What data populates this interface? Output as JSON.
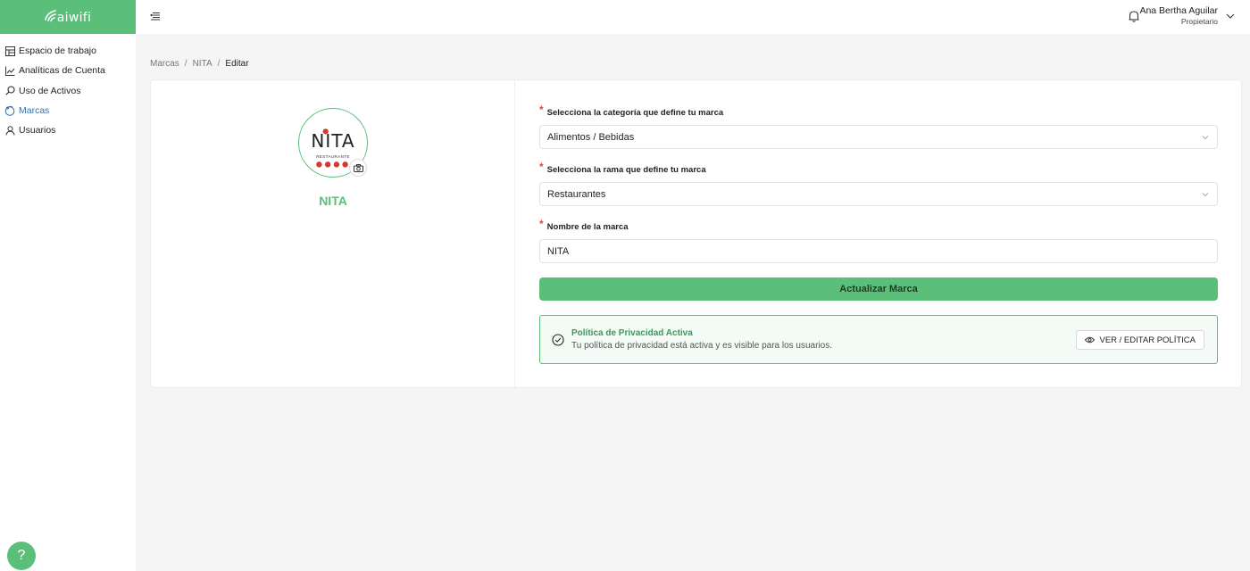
{
  "logo": {
    "text": "aiwifi"
  },
  "sidebar": {
    "items": [
      {
        "label": "Espacio de trabajo",
        "icon": "workspace-icon"
      },
      {
        "label": "Analíticas de Cuenta",
        "icon": "chart-icon"
      },
      {
        "label": "Uso de Activos",
        "icon": "search-icon"
      },
      {
        "label": "Marcas",
        "icon": "brand-icon",
        "active": true
      },
      {
        "label": "Usuarios",
        "icon": "user-icon"
      }
    ]
  },
  "help": {
    "label": "?"
  },
  "topbar": {
    "user_name": "Ana Bertha Aguilar",
    "user_role": "Propietario"
  },
  "breadcrumb": {
    "items": [
      "Marcas",
      "NITA",
      "Editar"
    ],
    "separator": "/"
  },
  "brand": {
    "name": "NITA",
    "logo_word": "NITA",
    "logo_sub": "RESTAURANTE"
  },
  "form": {
    "category_label": "Selecciona la categoría que define tu marca",
    "category_value": "Alimentos / Bebidas",
    "branch_label": "Selecciona la rama que define tu marca",
    "branch_value": "Restaurantes",
    "name_label": "Nombre de la marca",
    "name_value": "NITA",
    "required_mark": "*",
    "submit_label": "Actualizar Marca"
  },
  "policy": {
    "title": "Política de Privacidad Activa",
    "description": "Tu política de privacidad está activa y es visible para los usuarios.",
    "button_label": "VER / EDITAR POLÍTICA"
  },
  "colors": {
    "accent": "#5bbf7a",
    "accent_text": "#3a9a57",
    "required": "#e04a4a",
    "active_nav": "#3a6fa6"
  }
}
